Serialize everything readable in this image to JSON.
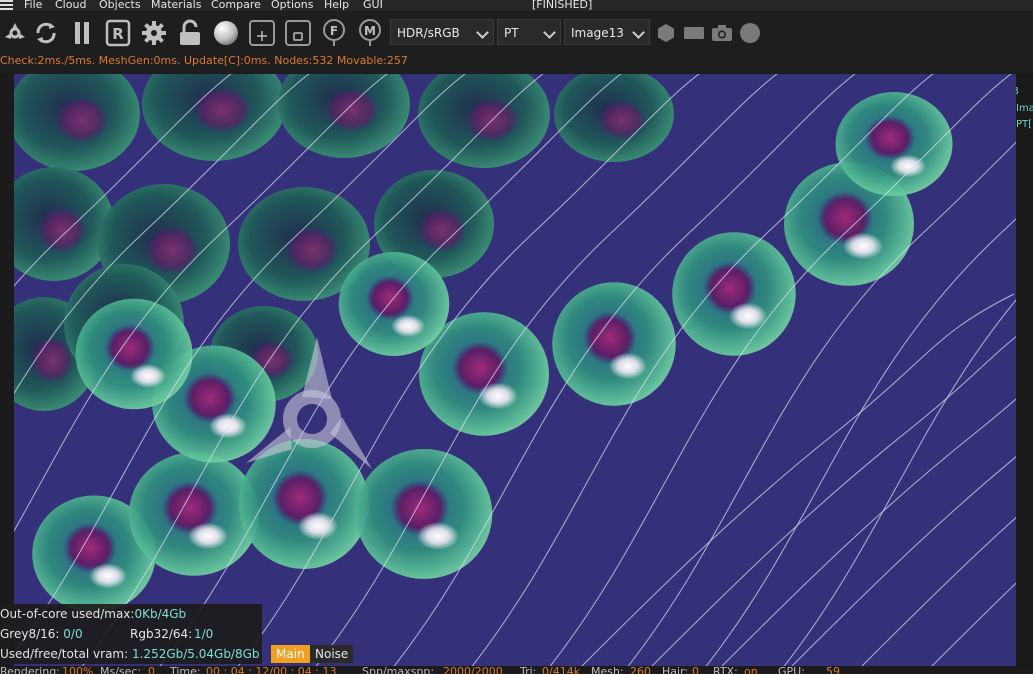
{
  "menu": {
    "items": [
      "File",
      "Cloud",
      "Objects",
      "Materials",
      "Compare",
      "Options",
      "Help",
      "GUI"
    ],
    "status": "[FINISHED]"
  },
  "toolbar": {
    "icons": [
      "octane-logo-icon",
      "reset-icon",
      "pause-icon",
      "restart-r-icon",
      "settings-gear-icon",
      "lock-icon",
      "sphere-icon",
      "region-add-icon",
      "region-focus-icon",
      "focus-f-icon",
      "material-m-icon"
    ],
    "color_space": "HDR/sRGB",
    "render_kernel": "PT",
    "image_name": "Image13",
    "right_icons": [
      "hexagon-icon",
      "rectangle-icon",
      "camera-icon",
      "circle-icon"
    ]
  },
  "stats_line": "Check:2ms./5ms. MeshGen:0ms. Update[C]:0ms. Nodes:532 Movable:257",
  "right_panel": {
    "ab_label": "A  B",
    "line2": "Ima",
    "line3": "PT["
  },
  "info": {
    "ooc_label": "Out-of-core used/max:",
    "ooc_value": "0Kb/4Gb",
    "grey_label": "Grey8/16:",
    "grey_value": "0/0",
    "rgb_label": "Rgb32/64:",
    "rgb_value": "1/0",
    "vram_label": "Used/free/total vram:",
    "vram_value": "1.252Gb/5.04Gb/8Gb"
  },
  "modes": {
    "main": "Main",
    "noise": "Noise"
  },
  "bottom": {
    "rendering_label": "Rendering:",
    "rendering_value": "100%",
    "ms_label": "Ms/sec:",
    "ms_value": "0",
    "time_label": "Time:",
    "time_value": "00 : 04 : 12/00 : 04 : 13",
    "spp_label": "Spp/maxspp:",
    "spp_value": "2000/2000",
    "tri_label": "Tri:",
    "tri_value": "0/414k",
    "mesh_label": "Mesh:",
    "mesh_value": "260",
    "hair_label": "Hair:",
    "hair_value": "0",
    "rtx_label": "RTX:",
    "rtx_value": "on",
    "gpu_label": "GPU:",
    "gpu_value": "59"
  },
  "colors": {
    "background": "#35307a",
    "accent_orange": "#f0a020",
    "stat_orange": "#d87a35",
    "value_teal": "#7fe0cf"
  }
}
